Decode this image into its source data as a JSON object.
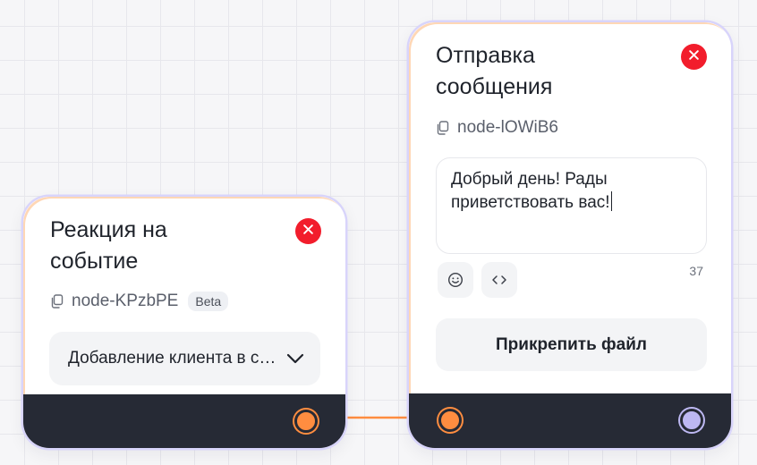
{
  "nodes": {
    "reaction": {
      "title": "Реакция на\nсобытие",
      "id_label": "node-KPzbPE",
      "badge": "Beta",
      "event_select": "Добавление клиента в систему"
    },
    "message": {
      "title": "Отправка\nсообщения",
      "id_label": "node-lOWiB6",
      "text": "Добрый день! Рады приветствовать вас!",
      "char_count": "37",
      "attach_label": "Прикрепить файл"
    }
  },
  "icons": {
    "close": "close-icon",
    "copy": "copy-icon",
    "chevron": "chevron-down-icon",
    "emoji": "emoji-icon",
    "code": "code-icon"
  },
  "colors": {
    "close_button": "#f21d2c",
    "footer": "#262a35",
    "port_orange": "#ff8d40",
    "port_purple": "#bdb8f2",
    "connector": "#ff8d40",
    "node_border": "#d8d4fb"
  }
}
